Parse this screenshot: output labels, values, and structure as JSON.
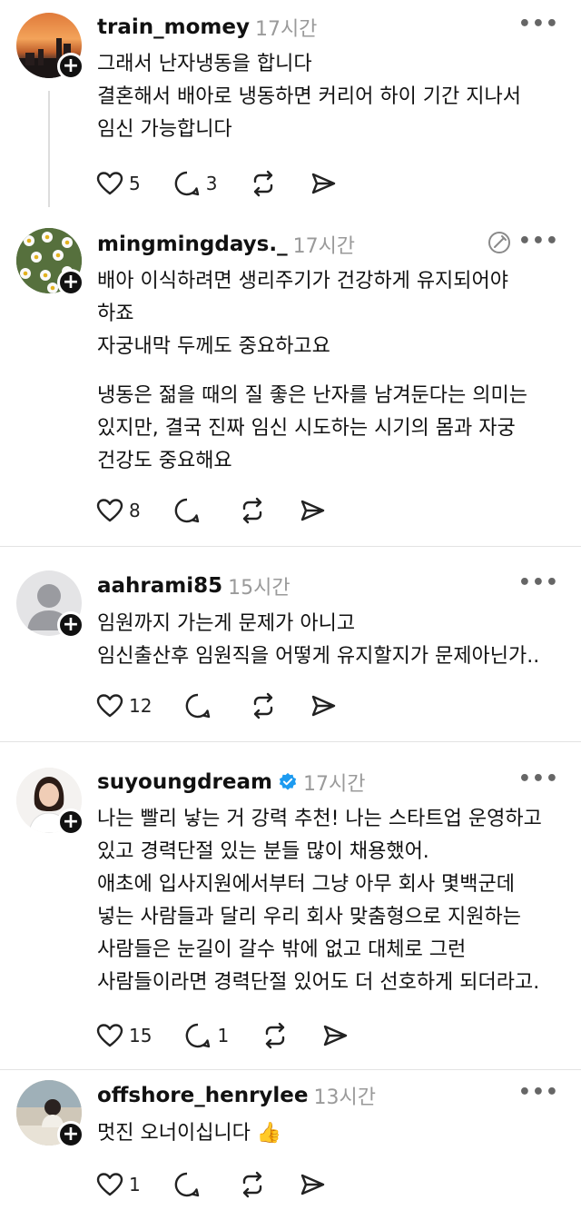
{
  "posts": [
    {
      "username": "train_momey",
      "time": "17시간",
      "more": "•••",
      "paragraphs": [
        "그래서 난자냉동을 합니다\n결혼해서 배아로 냉동하면 커리어 하이 기간 지나서\n임신 가능합니다"
      ],
      "likes": "5",
      "replies": "3",
      "avatar": "sunset-city-photo"
    },
    {
      "username": "mingmingdays._",
      "time": "17시간",
      "more": "•••",
      "paragraphs": [
        "배아 이식하려면 생리주기가 건강하게 유지되어야\n하죠\n자궁내막 두께도 중요하고요",
        "냉동은 젊을 때의 질 좋은 난자를 남겨둔다는 의미는\n있지만, 결국 진짜 임신 시도하는 시기의 몸과 자궁\n건강도 중요해요"
      ],
      "likes": "8",
      "replies": "",
      "avatar": "daisy-flowers-photo"
    },
    {
      "username": "aahrami85",
      "time": "15시간",
      "more": "•••",
      "paragraphs": [
        "임원까지 가는게 문제가 아니고\n임신출산후 임원직을 어떻게 유지할지가 문제아닌가.."
      ],
      "likes": "12",
      "replies": "",
      "avatar": "default-person"
    },
    {
      "username": "suyoungdream",
      "time": "17시간",
      "more": "•••",
      "paragraphs": [
        "나는 빨리 낳는 거 강력 추천! 나는 스타트업 운영하고\n있고 경력단절 있는 분들 많이 채용했어.\n애초에 입사지원에서부터 그냥 아무 회사 몇백군데\n넣는 사람들과 달리 우리 회사 맞춤형으로 지원하는\n사람들은 눈길이 갈수 밖에 없고 대체로 그런\n사람들이라면 경력단절 있어도 더 선호하게 되더라고."
      ],
      "likes": "15",
      "replies": "1",
      "avatar": "woman-portrait"
    },
    {
      "username": "offshore_henrylee",
      "time": "13시간",
      "more": "•••",
      "paragraphs": [
        "멋진 오너이십니다 👍"
      ],
      "likes": "1",
      "replies": "",
      "avatar": "man-at-desk-photo"
    }
  ],
  "colors": {
    "text": "#111111",
    "muted": "#9a9a9a",
    "verified": "#1d9bf0",
    "divider": "#e3e3e3"
  }
}
